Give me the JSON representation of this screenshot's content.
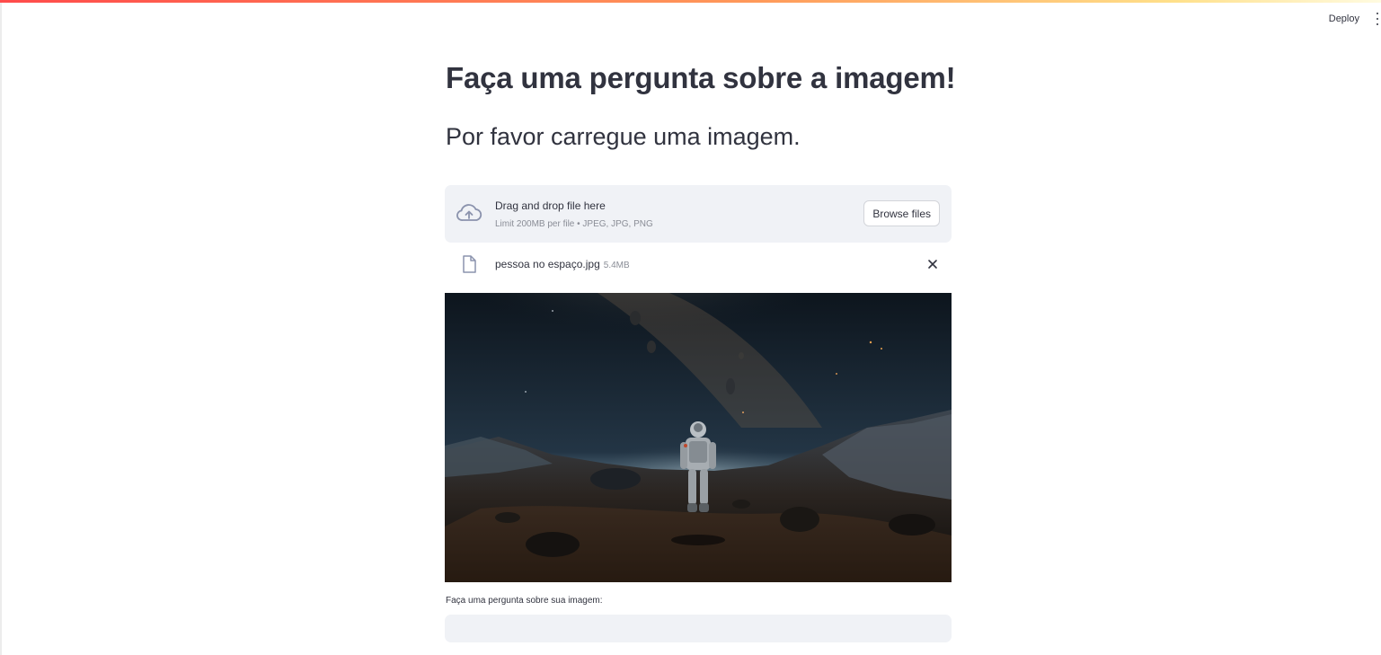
{
  "header": {
    "deploy_label": "Deploy",
    "menu_icon": "vertical-ellipsis-icon"
  },
  "main": {
    "title": "Faça uma pergunta sobre a imagem!",
    "subtitle": "Por favor carregue uma imagem."
  },
  "uploader": {
    "icon": "cloud-upload-icon",
    "drop_text": "Drag and drop file here",
    "limit_text": "Limit 200MB per file • JPEG, JPG, PNG",
    "browse_label": "Browse files"
  },
  "uploaded_file": {
    "icon": "file-icon",
    "name": "pessoa no espaço.jpg",
    "size": "5.4MB",
    "remove_icon": "close-icon"
  },
  "question": {
    "label": "Faça uma pergunta sobre sua imagem:",
    "value": "",
    "placeholder": ""
  },
  "colors": {
    "accent": "#ff4b4b",
    "text": "#31333f",
    "muted": "#8a8d96",
    "panel": "#f0f2f6"
  }
}
